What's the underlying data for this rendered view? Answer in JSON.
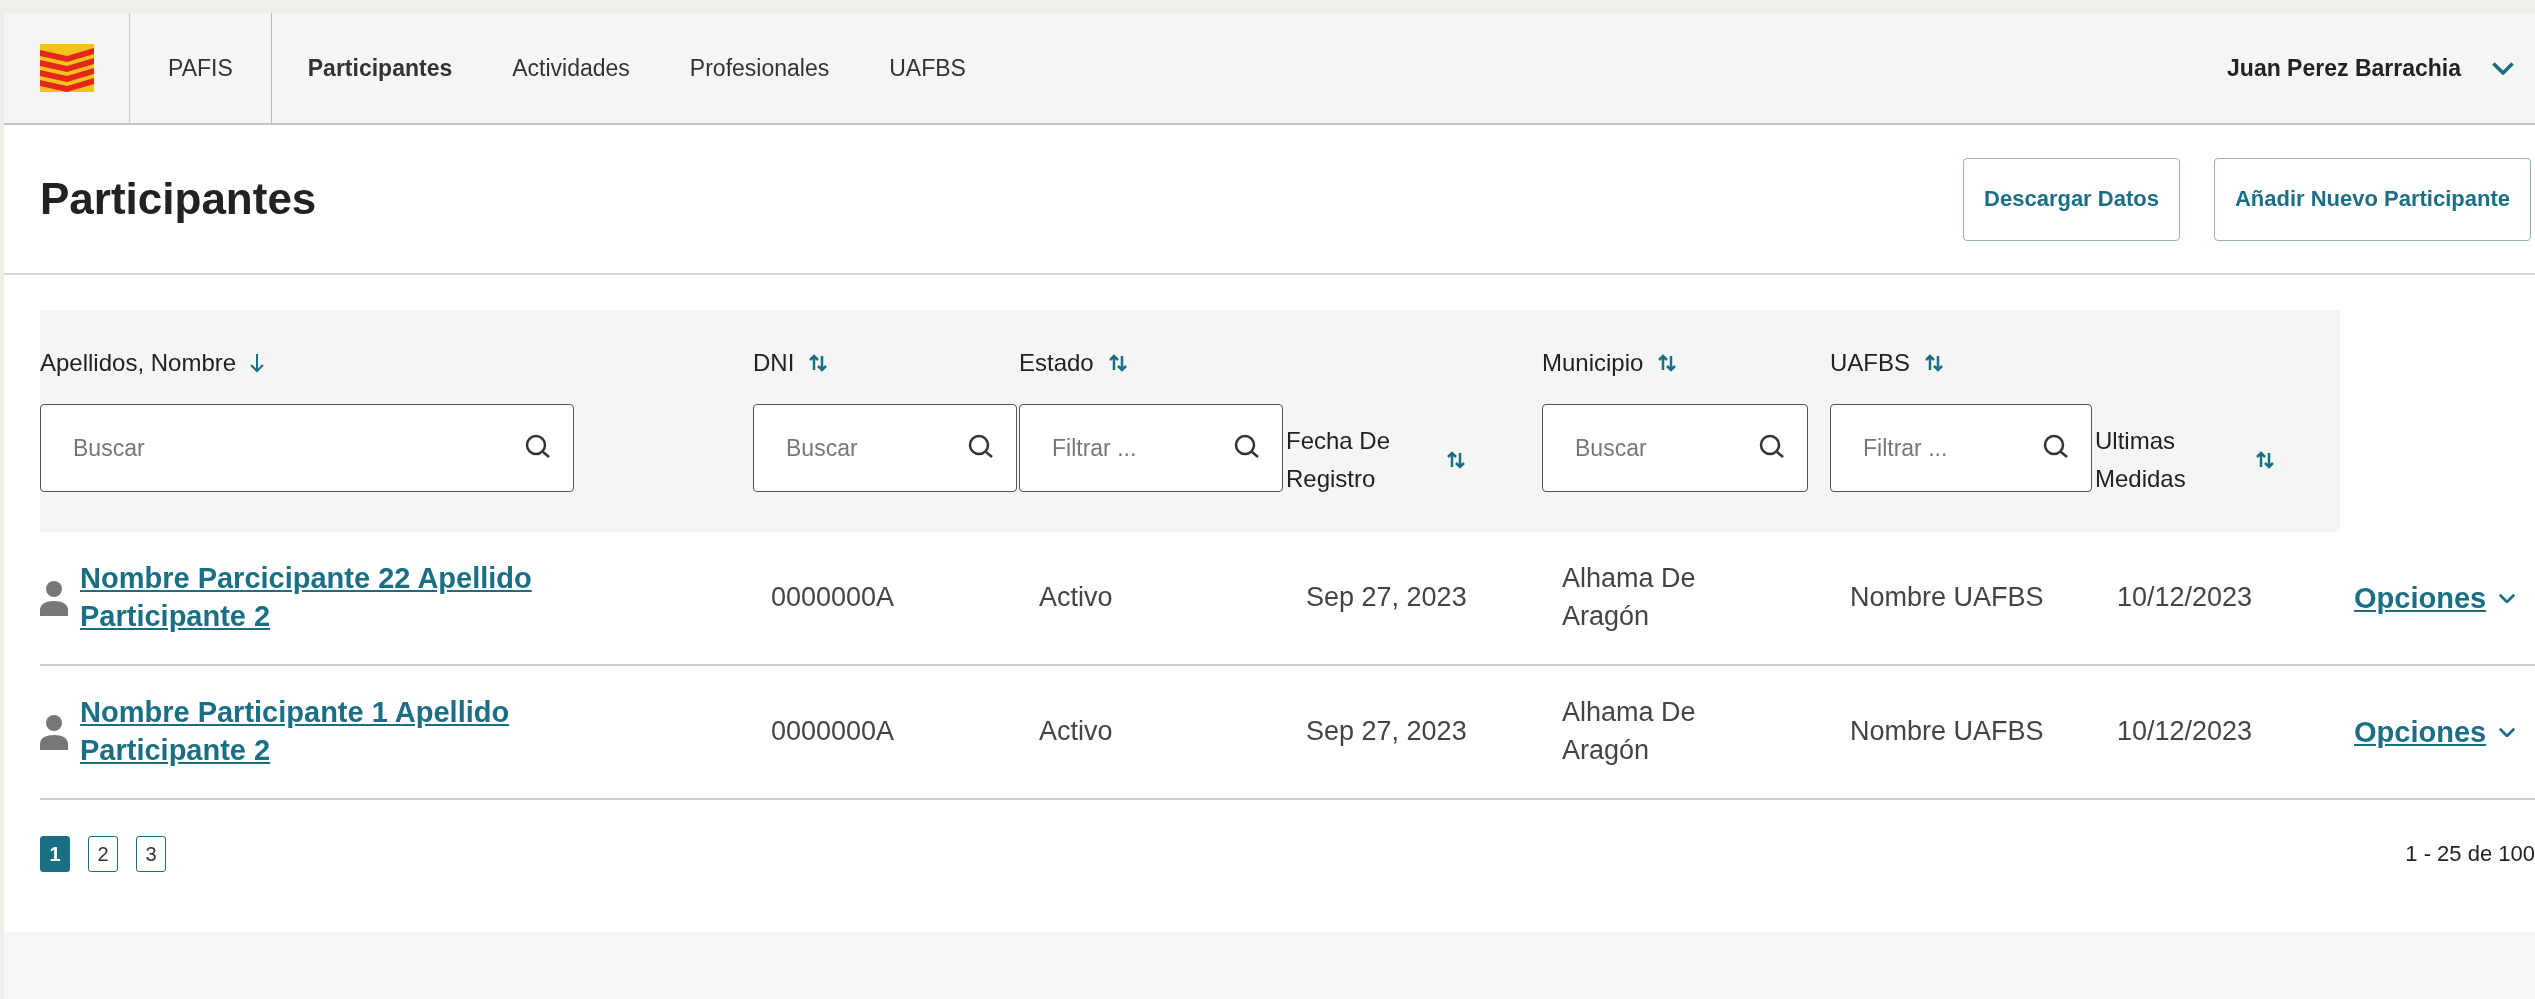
{
  "nav": {
    "items": [
      {
        "label": "PAFIS",
        "selected": false
      },
      {
        "label": "Participantes",
        "selected": true
      },
      {
        "label": "Actividades",
        "selected": false
      },
      {
        "label": "Profesionales",
        "selected": false
      },
      {
        "label": "UAFBS",
        "selected": false
      }
    ],
    "user": "Juan Perez Barrachia"
  },
  "page": {
    "title": "Participantes",
    "buttons": [
      "Descargar Datos",
      "Añadir Nuevo Participante"
    ]
  },
  "table": {
    "columns": [
      {
        "label": "Apellidos, Nombre",
        "sorted": true,
        "kind": "filter",
        "placeholder": "Buscar"
      },
      {
        "label": "DNI",
        "sorted": false,
        "kind": "filter",
        "placeholder": "Buscar"
      },
      {
        "label": "Estado",
        "sorted": false,
        "kind": "filter",
        "placeholder": "Filtrar ..."
      },
      {
        "label": "Fecha De Registro",
        "sorted": false,
        "kind": "plain"
      },
      {
        "label": "Municipio",
        "sorted": false,
        "kind": "filter",
        "placeholder": "Buscar"
      },
      {
        "label": "UAFBS",
        "sorted": false,
        "kind": "filter",
        "placeholder": "Filtrar ..."
      },
      {
        "label": "Ultimas Medidas",
        "sorted": false,
        "kind": "plain"
      }
    ],
    "rows": [
      {
        "name": "Nombre Parcicipante 22 Apellido Participante 2",
        "dni": "0000000A",
        "estado": "Activo",
        "fecha": "Sep 27, 2023",
        "municipio": "Alhama De Aragón",
        "uafbs": "Nombre UAFBS",
        "medidas": "10/12/2023",
        "action": "Opciones"
      },
      {
        "name": "Nombre Participante 1 Apellido Participante 2",
        "dni": "0000000A",
        "estado": "Activo",
        "fecha": "Sep 27, 2023",
        "municipio": "Alhama De Aragón",
        "uafbs": "Nombre UAFBS",
        "medidas": "10/12/2023",
        "action": "Opciones"
      }
    ]
  },
  "pagination": {
    "pages": [
      {
        "label": "1",
        "selected": true
      },
      {
        "label": "2",
        "selected": false
      },
      {
        "label": "3",
        "selected": false
      }
    ],
    "range": "1 - 25 de 100"
  }
}
